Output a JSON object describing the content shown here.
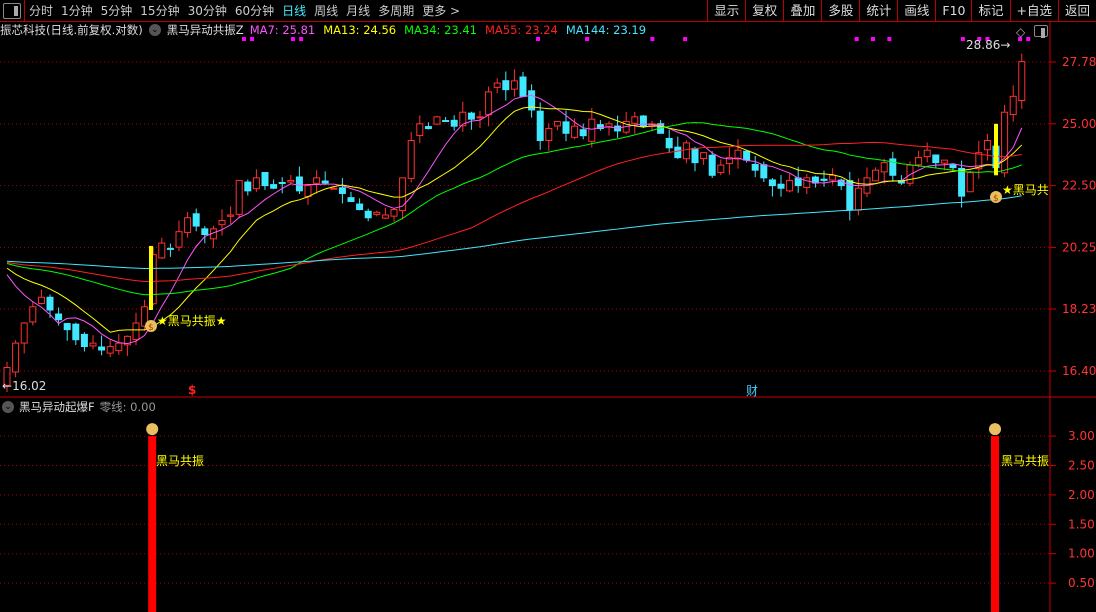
{
  "toolbar": {
    "periods": [
      "分时",
      "1分钟",
      "5分钟",
      "15分钟",
      "30分钟",
      "60分钟",
      "日线",
      "周线",
      "月线",
      "多周期",
      "更多 >"
    ],
    "active": "日线",
    "right": [
      "显示",
      "复权",
      "叠加",
      "多股",
      "统计",
      "画线",
      "F10",
      "标记",
      "+自选",
      "返回"
    ]
  },
  "legend": {
    "title": "振芯科技(日线.前复权.对数)",
    "indicator": "黑马异动共振Z",
    "ma": [
      {
        "label": "MA7: 25.81",
        "color": "#ff55ff"
      },
      {
        "label": "MA13: 24.56",
        "color": "#ffff00"
      },
      {
        "label": "MA34: 23.41",
        "color": "#00ff00"
      },
      {
        "label": "MA55: 23.24",
        "color": "#ff2020"
      },
      {
        "label": "MA144: 23.19",
        "color": "#40e8ff"
      }
    ]
  },
  "price_axis": [
    "27.78",
    "25.00",
    "22.50",
    "20.25",
    "18.23",
    "16.40"
  ],
  "annotations": {
    "high": "28.86",
    "low": "16.02",
    "signal_1": "★黑马共振★",
    "signal_2": "★黑马共",
    "dollar": "$",
    "cai": "财"
  },
  "sub": {
    "title": "黑马异动起爆F",
    "zero": "零线: 0.00",
    "axis": [
      "3.00",
      "2.50",
      "2.00",
      "1.50",
      "1.00",
      "0.50"
    ],
    "label": "黑马共振",
    "signals": [
      {
        "index": 17,
        "value": 3.0
      },
      {
        "index": 115,
        "value": 3.0
      }
    ]
  },
  "chart_data": {
    "type": "candlestick",
    "scale": "log",
    "closes": [
      16.5,
      17.2,
      17.8,
      18.3,
      18.6,
      18.2,
      17.9,
      17.6,
      17.3,
      17.1,
      17.2,
      17.0,
      17.1,
      17.2,
      17.4,
      17.8,
      18.3,
      20.0,
      20.4,
      20.2,
      20.8,
      21.3,
      21.0,
      20.7,
      20.9,
      21.2,
      21.4,
      22.7,
      22.3,
      22.8,
      22.5,
      22.4,
      22.6,
      22.7,
      22.3,
      22.5,
      22.8,
      22.6,
      22.4,
      22.2,
      21.9,
      21.6,
      21.3,
      21.5,
      21.4,
      21.6,
      22.8,
      24.3,
      25.0,
      24.8,
      25.3,
      25.1,
      24.9,
      25.5,
      25.2,
      25.3,
      26.4,
      26.8,
      26.5,
      26.9,
      26.2,
      25.6,
      24.3,
      24.8,
      25.1,
      24.6,
      24.9,
      24.5,
      25.2,
      24.8,
      25.0,
      24.7,
      25.1,
      25.3,
      24.9,
      25.0,
      24.6,
      24.0,
      23.6,
      24.2,
      23.4,
      23.8,
      22.9,
      23.3,
      23.6,
      23.9,
      23.5,
      23.1,
      22.8,
      22.5,
      22.4,
      22.7,
      22.5,
      22.8,
      22.6,
      22.7,
      22.9,
      22.5,
      21.6,
      22.4,
      22.8,
      23.1,
      23.4,
      22.9,
      22.6,
      23.3,
      23.6,
      23.9,
      23.4,
      23.5,
      23.2,
      22.1,
      23.0,
      23.8,
      24.3,
      23.2,
      25.5,
      26.2,
      27.8
    ],
    "ma_periods": [
      7,
      13,
      34,
      55,
      144
    ],
    "ylim": [
      16.02,
      28.86
    ]
  },
  "signal_dots": [
    29,
    30,
    35,
    36,
    65,
    71,
    79,
    83,
    104,
    106,
    108,
    117,
    119,
    120,
    124,
    125
  ]
}
